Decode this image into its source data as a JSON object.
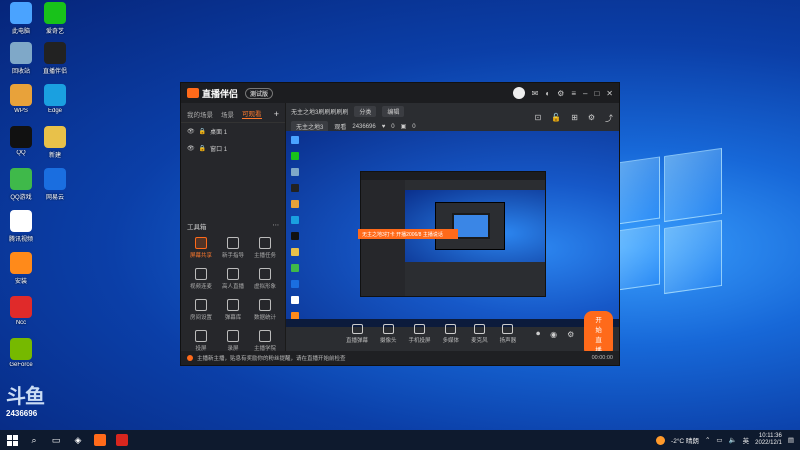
{
  "desktop": {
    "icons": [
      {
        "label": "此电脑",
        "color": "#4aa3ff"
      },
      {
        "label": "爱奇艺",
        "color": "#18c21a"
      },
      {
        "label": "回收站",
        "color": "#7fa8c8"
      },
      {
        "label": "直播伴侣",
        "color": "#222"
      },
      {
        "label": "WPS",
        "color": "#e8a23a"
      },
      {
        "label": "Edge",
        "color": "#1aa0e0"
      },
      {
        "label": "QQ",
        "color": "#111"
      },
      {
        "label": "新建",
        "color": "#e8c14a"
      },
      {
        "label": "QQ游戏",
        "color": "#3fb94a"
      },
      {
        "label": "网易云",
        "color": "#1a6ee0"
      },
      {
        "label": "腾讯视频",
        "color": "#ffffff"
      },
      {
        "label": "安装",
        "color": "#ff8a1a"
      },
      {
        "label": "Ncc",
        "color": "#e02a2a"
      },
      {
        "label": "GeForce",
        "color": "#76b900"
      },
      {
        "label": "Steam",
        "color": "#1b2838"
      }
    ]
  },
  "watermark": {
    "big": "斗鱼",
    "number": "2436696"
  },
  "app": {
    "title": "直播伴侣",
    "version": "测试版",
    "scene_tabs": [
      "我的场景",
      "场景",
      "可观看"
    ],
    "active_tab": "可观看",
    "sources": [
      {
        "label": "桌面 1"
      },
      {
        "label": "窗口 1"
      }
    ],
    "tools_title": "工具箱",
    "tools": [
      {
        "label": "屏幕共享",
        "hot": true
      },
      {
        "label": "新手指导",
        "hot": false
      },
      {
        "label": "主播任务",
        "hot": false
      },
      {
        "label": "视频连麦",
        "hot": false
      },
      {
        "label": "高人直播",
        "hot": false
      },
      {
        "label": "虚拟形象",
        "hot": false
      },
      {
        "label": "房间设置",
        "hot": false
      },
      {
        "label": "弹幕库",
        "hot": false
      },
      {
        "label": "数据统计",
        "hot": false
      },
      {
        "label": "投屏",
        "hot": false
      },
      {
        "label": "录屏",
        "hot": false
      },
      {
        "label": "主播学院",
        "hot": false
      }
    ],
    "room": {
      "name": "无主之地3刷刷刷刷刷",
      "status": "分类",
      "edit": "编辑",
      "category": "无主之地3",
      "viewers_label": "观看",
      "viewers": "2436696",
      "likes": "0",
      "gifts": "0"
    },
    "preview_tag": "无主之地3打卡 开播2006/8 主播说话",
    "controls": [
      {
        "label": "直播弹幕"
      },
      {
        "label": "摄像头"
      },
      {
        "label": "手机投屏"
      },
      {
        "label": "多媒体"
      },
      {
        "label": "麦克风"
      },
      {
        "label": "扬声器"
      }
    ],
    "start_button": "开始直播",
    "notice": "主播新主播，贴息有奖励你的粉丝提醒，请在直播开始前检查",
    "timer": "00:00:00"
  },
  "taskbar": {
    "weather": "-2°C 晴朗",
    "lang": "英",
    "time": "10:11:36",
    "date": "2022/12/1"
  }
}
